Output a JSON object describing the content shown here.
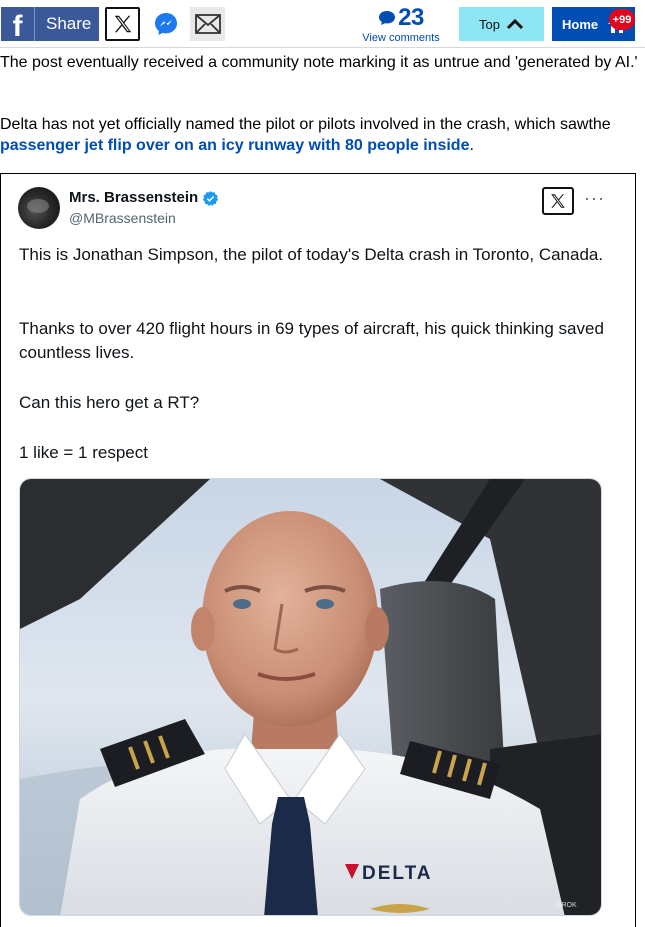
{
  "sharebar": {
    "facebook_icon": "f",
    "share_label": "Share",
    "x_icon": "x-logo-icon",
    "messenger_icon": "messenger-icon",
    "mail_icon": "envelope-icon",
    "comment_count": "23",
    "comments_label": "View comments",
    "top_label": "Top",
    "home_label": "Home",
    "home_badge": "+99",
    "colors": {
      "facebook": "#3b5998",
      "top_button": "#8ee6f4",
      "home_button": "#004db3",
      "badge": "#e3051c",
      "link": "#004db3"
    }
  },
  "article": {
    "paragraph_1": "The post eventually received a community note marking it as untrue and 'generated by AI.'",
    "paragraph_2_text": "Delta has not yet officially named the pilot or pilots involved in the crash, which sawthe ",
    "paragraph_2_link": "passenger jet flip over on an icy runway with 80 people inside",
    "paragraph_2_end": "."
  },
  "tweet": {
    "author_name": "Mrs. Brassenstein",
    "author_handle": "@MBrassenstein",
    "verified_icon": "verified-badge-icon",
    "more_icon": "···",
    "line_1": "This is Jonathan Simpson, the pilot of today's Delta crash in Toronto, Canada.",
    "line_2": "Thanks to over 420 flight hours in 69 types of aircraft, his quick thinking saved countless lives.",
    "line_3": "Can this hero get a RT?",
    "line_4": "1 like = 1 respect",
    "photo": {
      "shirt_logo_text": "DELTA",
      "watermark_text": "GROK"
    }
  }
}
